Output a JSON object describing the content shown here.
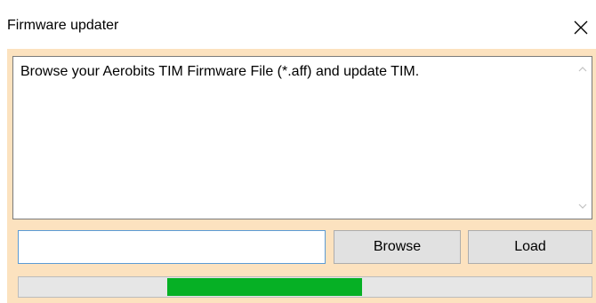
{
  "window": {
    "title": "Firmware updater"
  },
  "message": {
    "text": "Browse your Aerobits TIM Firmware File (*.aff) and update TIM."
  },
  "file_input": {
    "value": "",
    "placeholder": ""
  },
  "buttons": {
    "browse_label": "Browse",
    "load_label": "Load"
  },
  "progress": {
    "segment_start_fraction": 0.26,
    "segment_end_fraction": 0.6,
    "fill_color": "#06b025"
  },
  "colors": {
    "client_background": "#fce2bf",
    "button_background": "#e1e1e1",
    "input_border": "#5b9bd5"
  },
  "icons": {
    "close": "close-icon",
    "scroll_up": "chevron-up-icon",
    "scroll_down": "chevron-down-icon"
  }
}
